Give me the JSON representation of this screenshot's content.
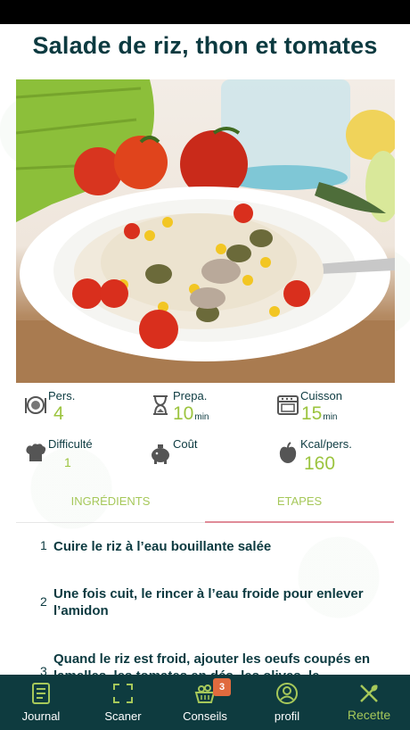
{
  "recipe": {
    "title": "Salade de riz, thon et tomates"
  },
  "stats": {
    "pers_label": "Pers.",
    "pers_value": "4",
    "prepa_label": "Prepa.",
    "prepa_value": "10",
    "prepa_unit": "min",
    "cuisson_label": "Cuisson",
    "cuisson_value": "15",
    "cuisson_unit": "min",
    "difficulte_label": "Difficulté",
    "difficulte_value": "1",
    "cout_label": "Coût",
    "kcal_label": "Kcal/pers.",
    "kcal_value": "160"
  },
  "tabs": {
    "ingredients": "INGRÉDIENTS",
    "etapes": "ETAPES"
  },
  "steps": [
    {
      "num": "1",
      "text": "Cuire le riz à l’eau bouillante salée"
    },
    {
      "num": "2",
      "text": "Une fois cuit, le rincer à l’eau froide pour enlever l’amidon"
    },
    {
      "num": "3",
      "text": "Quand le riz est froid, ajouter les oeufs coupés en lamelles, les tomates en dés, les olives, le"
    }
  ],
  "nav": {
    "journal": "Journal",
    "scaner": "Scaner",
    "conseils": "Conseils",
    "conseils_badge": "3",
    "profil": "profil",
    "recette": "Recette"
  },
  "colors": {
    "accent_green": "#a6c85a",
    "dark_teal": "#0e3b3f",
    "tab_underline": "#e08b98",
    "badge": "#e06a3e"
  }
}
